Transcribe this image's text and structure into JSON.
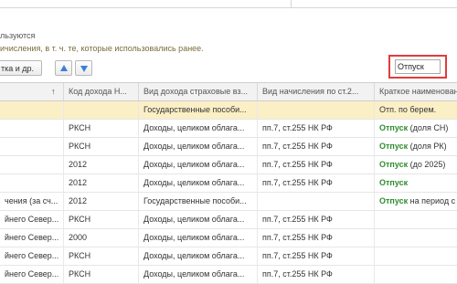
{
  "hints": {
    "line1": "льзуются",
    "line2": "ичисления, в т. ч. те, которые использовались ранее."
  },
  "toolbar": {
    "edit_label": "тка и др.",
    "up_icon": "arrow-up-icon",
    "down_icon": "arrow-down-icon"
  },
  "search": {
    "value": "Отпуск"
  },
  "table": {
    "sort_icon": "↑",
    "headers": [
      "",
      "Код дохода Н...",
      "Вид дохода страховые вз...",
      "Вид начисления по ст.2...",
      "Краткое наименован"
    ],
    "rows": [
      {
        "c0": "",
        "c1": "",
        "c2": "Государственные пособи...",
        "c3": "",
        "c4_green": "",
        "c4_rest": "Отп. по берем."
      },
      {
        "c0": "",
        "c1": "РКСН",
        "c2": "Доходы, целиком облага...",
        "c3": "пп.7, ст.255 НК РФ",
        "c4_green": "Отпуск",
        "c4_rest": " (доля СН)"
      },
      {
        "c0": "",
        "c1": "РКСН",
        "c2": "Доходы, целиком облага...",
        "c3": "пп.7, ст.255 НК РФ",
        "c4_green": "Отпуск",
        "c4_rest": " (доля РК)"
      },
      {
        "c0": "",
        "c1": "2012",
        "c2": "Доходы, целиком облага...",
        "c3": "пп.7, ст.255 НК РФ",
        "c4_green": "Отпуск",
        "c4_rest": " (до 2025)"
      },
      {
        "c0": "",
        "c1": "2012",
        "c2": "Доходы, целиком облага...",
        "c3": "пп.7, ст.255 НК РФ",
        "c4_green": "Отпуск",
        "c4_rest": ""
      },
      {
        "c0": "чения (за сч...",
        "c1": "2012",
        "c2": "Государственные пособи...",
        "c3": "",
        "c4_green": "Отпуск",
        "c4_rest": " на период с"
      },
      {
        "c0": "йнего Север...",
        "c1": "РКСН",
        "c2": "Доходы, целиком облага...",
        "c3": "пп.7, ст.255 НК РФ",
        "c4_green": "",
        "c4_rest": ""
      },
      {
        "c0": "йнего Север...",
        "c1": "2000",
        "c2": "Доходы, целиком облага...",
        "c3": "пп.7, ст.255 НК РФ",
        "c4_green": "",
        "c4_rest": ""
      },
      {
        "c0": "йнего Север...",
        "c1": "РКСН",
        "c2": "Доходы, целиком облага...",
        "c3": "пп.7, ст.255 НК РФ",
        "c4_green": "",
        "c4_rest": ""
      },
      {
        "c0": "йнего Север...",
        "c1": "РКСН",
        "c2": "Доходы, целиком облага...",
        "c3": "пп.7, ст.255 НК РФ",
        "c4_green": "",
        "c4_rest": ""
      }
    ]
  },
  "colors": {
    "selected_row": "#fbefc5",
    "highlight_border": "#e23b3b",
    "match_text": "#2f8d2f"
  }
}
